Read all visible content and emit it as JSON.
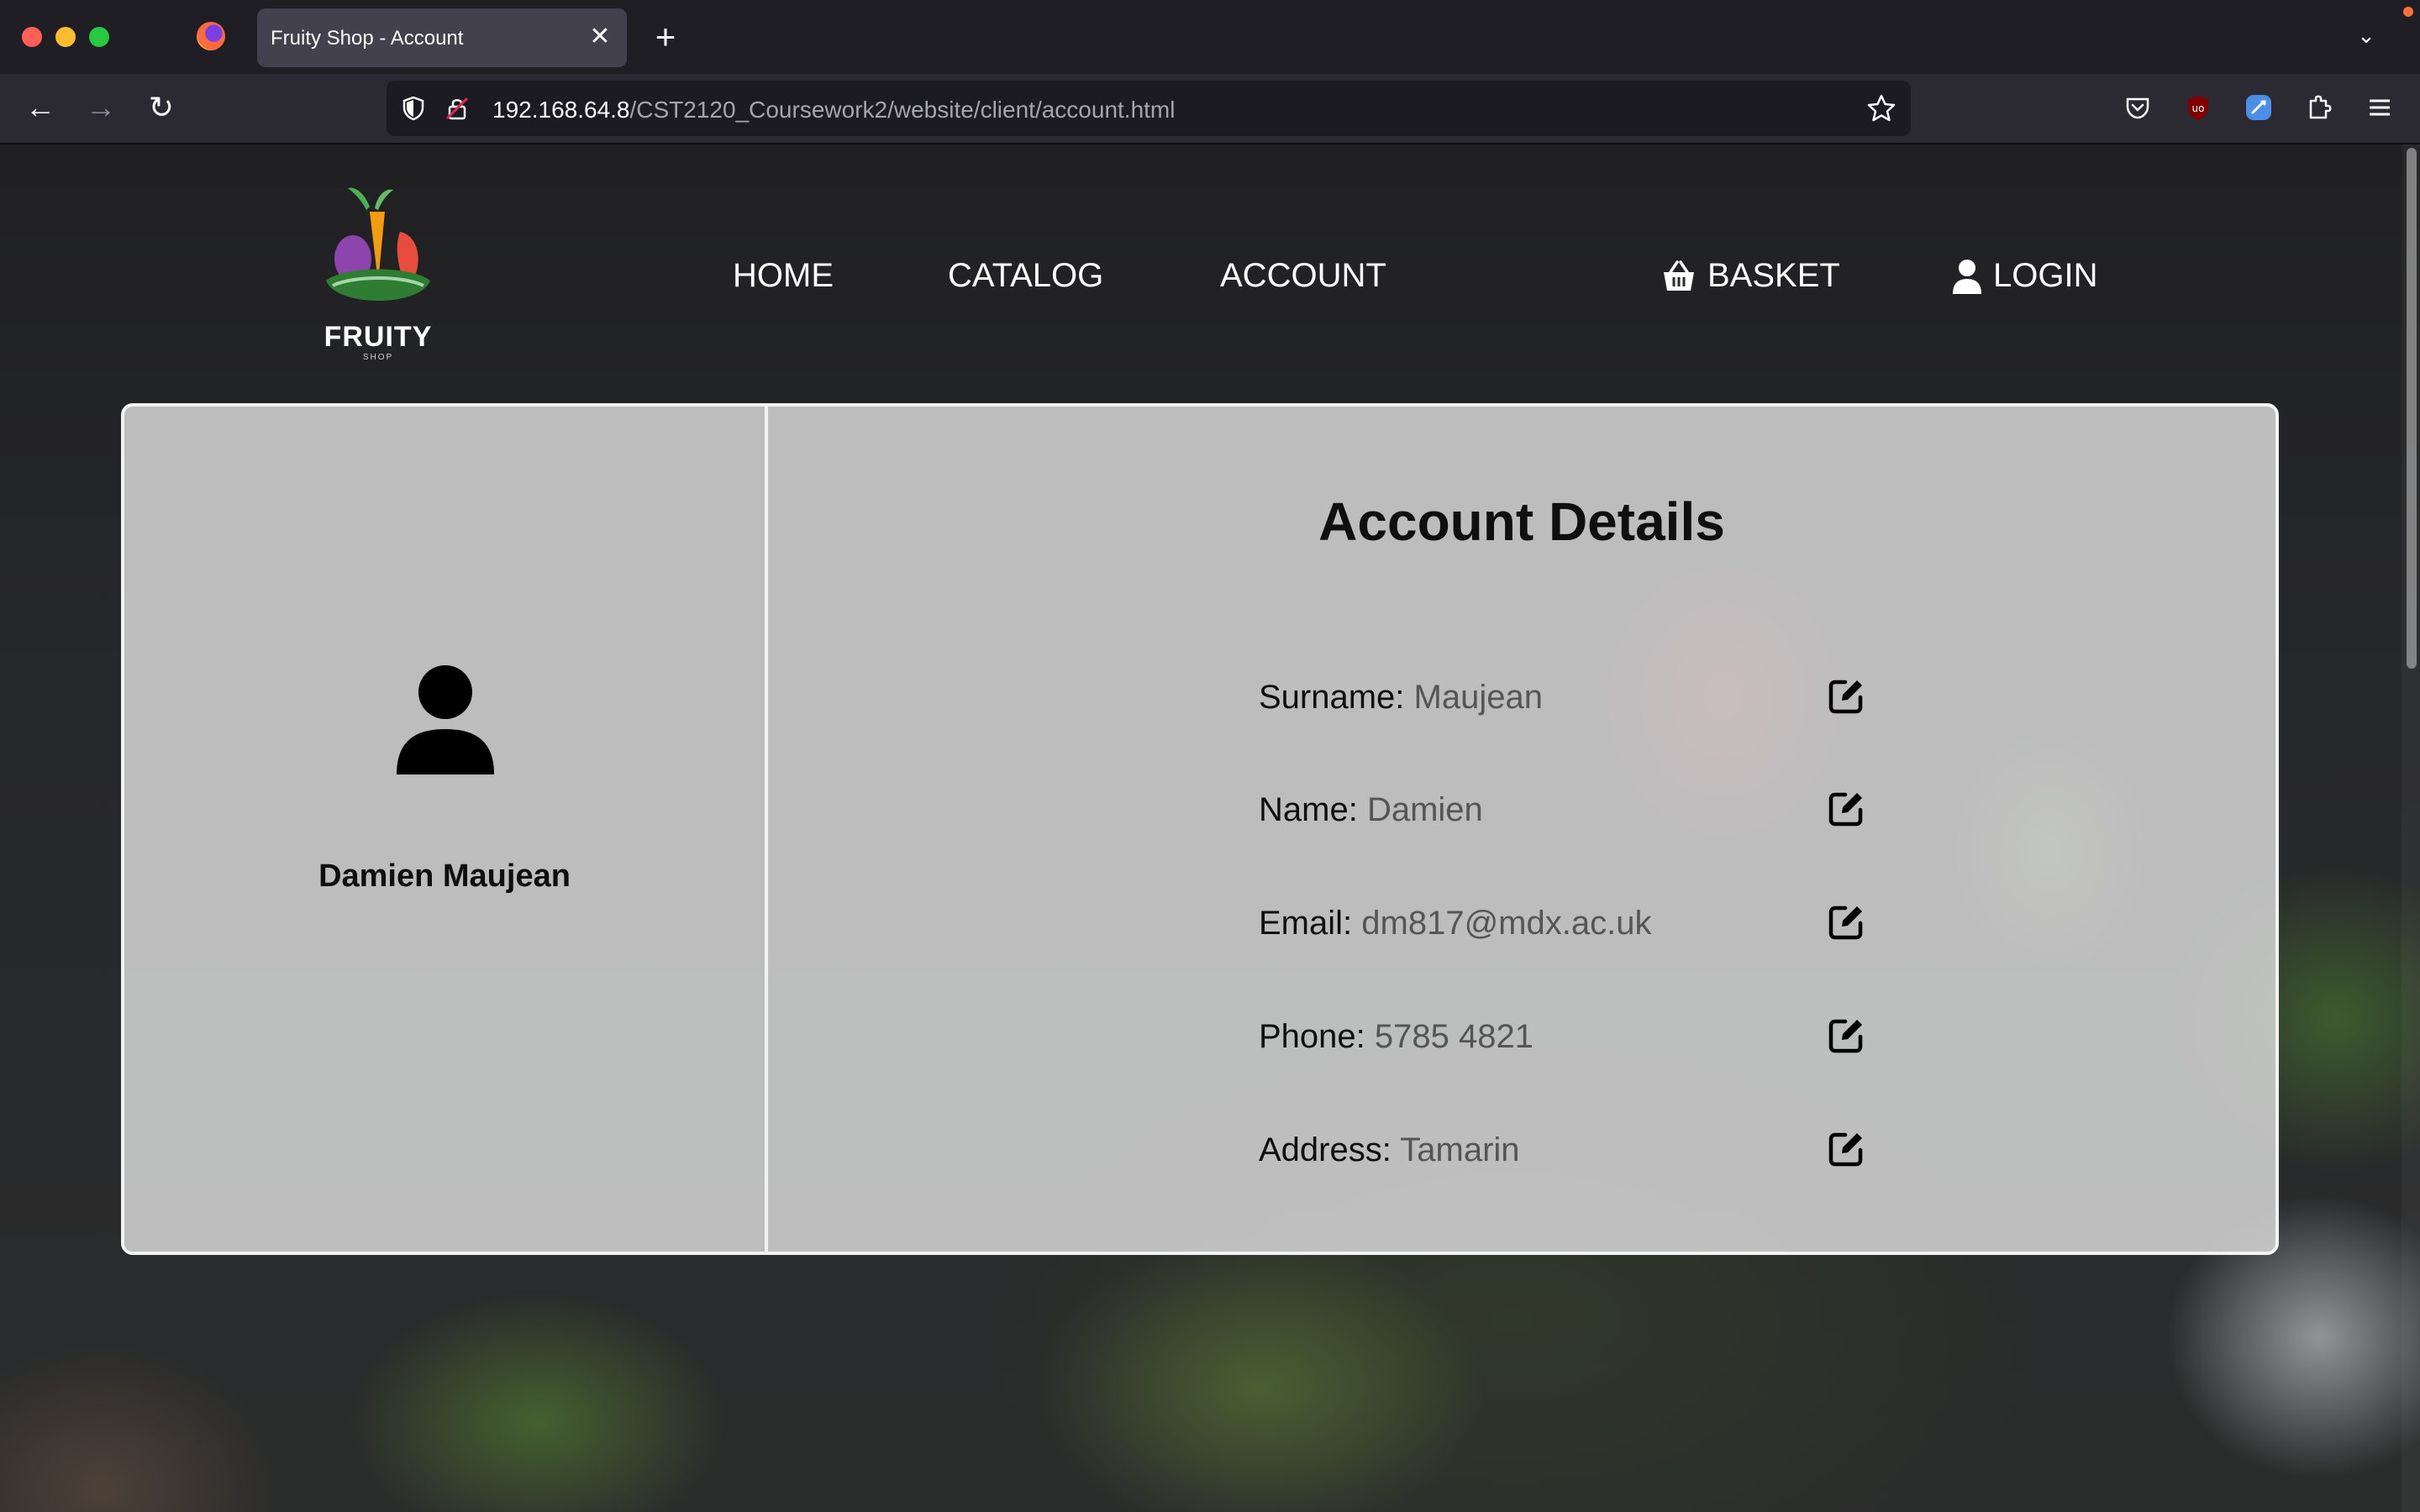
{
  "browser": {
    "tab_title": "Fruity Shop - Account",
    "tab_close": "✕",
    "new_tab": "+",
    "tab_list": "⌄",
    "back": "←",
    "forward": "→",
    "reload": "↻",
    "url_host": "192.168.64.8",
    "url_path": "/CST2120_Coursework2/website/client/account.html"
  },
  "site": {
    "logo_word": "FRUITY",
    "logo_sub": "SHOP",
    "nav": {
      "home": "HOME",
      "catalog": "CATALOG",
      "account": "ACCOUNT",
      "basket": "BASKET",
      "login": "LOGIN"
    }
  },
  "account": {
    "full_name": "Damien Maujean",
    "title": "Account Details",
    "fields": [
      {
        "label": "Surname:",
        "value": "Maujean"
      },
      {
        "label": "Name:",
        "value": "Damien"
      },
      {
        "label": "Email:",
        "value": "dm817@mdx.ac.uk"
      },
      {
        "label": "Phone:",
        "value": "5785 4821"
      },
      {
        "label": "Address:",
        "value": "Tamarin"
      }
    ]
  },
  "icons": {
    "avatar": "user-silhouette-icon",
    "edit": "edit-pen-icon",
    "basket": "basket-icon",
    "login": "user-icon"
  },
  "colors": {
    "browser_tabbar": "#1f1e24",
    "browser_toolbar": "#2b2a33",
    "card_bg": "#d6d6d6",
    "card_border": "#f2f2f2",
    "value_text": "#555555",
    "label_text": "#0f0f0f"
  }
}
